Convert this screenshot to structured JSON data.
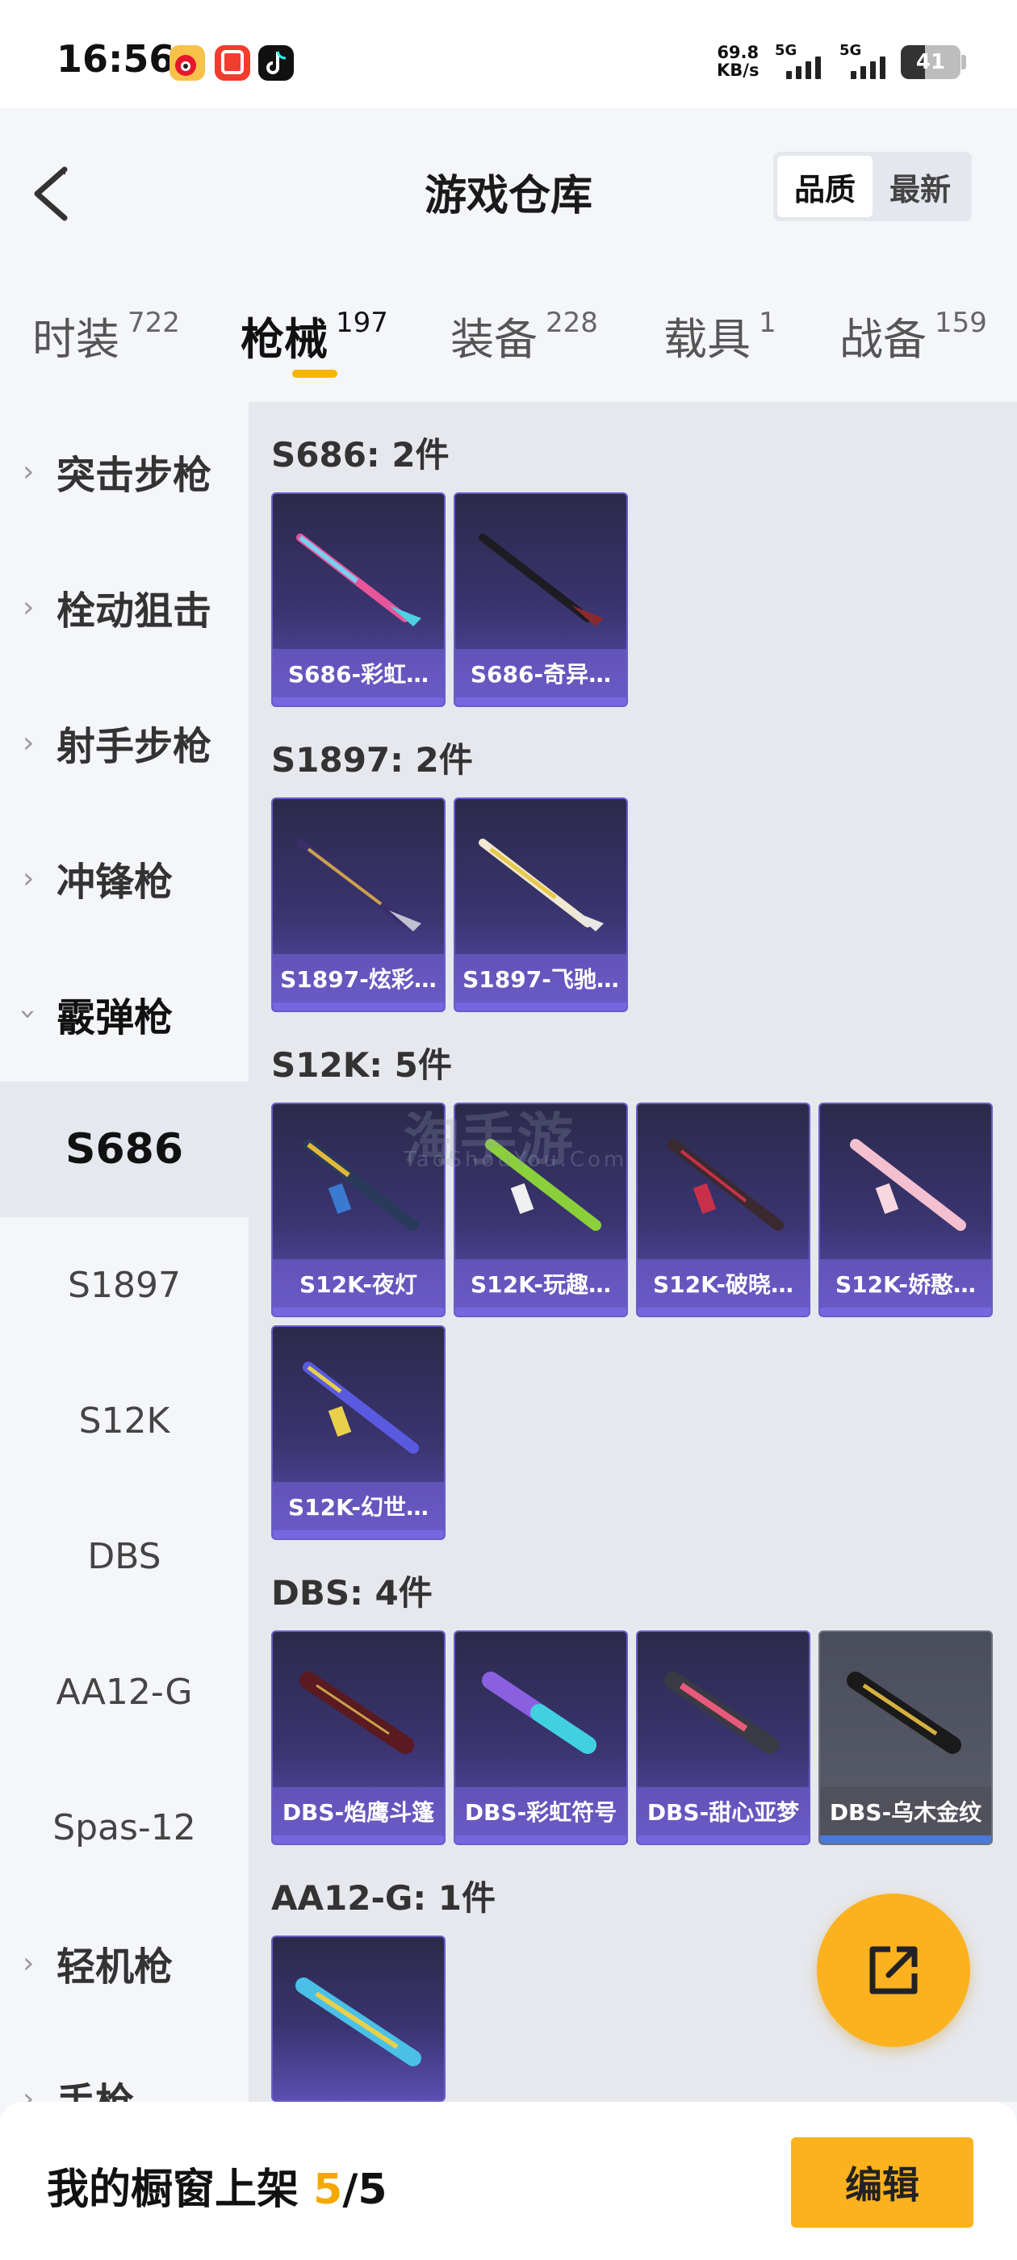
{
  "status_bar": {
    "time": "16:56",
    "net_speed_value": "69.8",
    "net_speed_unit": "KB/s",
    "signal1": "5G",
    "signal2": "5G",
    "battery": "41",
    "battery_level": 0.41
  },
  "header": {
    "title": "游戏仓库",
    "sort_options": [
      "品质",
      "最新"
    ],
    "sort_active": "品质"
  },
  "tabs": [
    {
      "label": "时装",
      "count": "722"
    },
    {
      "label": "枪械",
      "count": "197"
    },
    {
      "label": "装备",
      "count": "228"
    },
    {
      "label": "载具",
      "count": "1"
    },
    {
      "label": "战备",
      "count": "159"
    }
  ],
  "sidebar": {
    "categories": [
      "突击步枪",
      "栓动狙击",
      "射手步枪",
      "冲锋枪",
      "霰弹枪",
      "轻机枪",
      "手枪"
    ],
    "shotgun_subs": [
      "S686",
      "S1897",
      "S12K",
      "DBS",
      "AA12-G",
      "Spas-12"
    ],
    "active_sub": "S686"
  },
  "sections": [
    {
      "title": "S686: 2件",
      "items": [
        "S686-彩虹…",
        "S686-奇异…"
      ]
    },
    {
      "title": "S1897: 2件",
      "items": [
        "S1897-炫彩…",
        "S1897-飞驰…"
      ]
    },
    {
      "title": "S12K: 5件",
      "items": [
        "S12K-夜灯",
        "S12K-玩趣…",
        "S12K-破晓…",
        "S12K-娇憨…",
        "S12K-幻世…"
      ]
    },
    {
      "title": "DBS: 4件",
      "items": [
        "DBS-焰鹰斗篷",
        "DBS-彩虹符号",
        "DBS-甜心亚梦",
        "DBS-乌木金纹"
      ]
    },
    {
      "title": "AA12-G: 1件",
      "items": [
        ""
      ]
    }
  ],
  "watermark": {
    "main": "淘手游",
    "sub": "TaoShouYou.Com"
  },
  "bottom": {
    "label": "我的橱窗上架",
    "current": "5",
    "separator": "/",
    "total": "5",
    "edit_label": "编辑"
  },
  "colors": {
    "accent": "#fbb21e",
    "card_purple": "#5b4fb0",
    "card_grey": "#5a5d6a"
  }
}
